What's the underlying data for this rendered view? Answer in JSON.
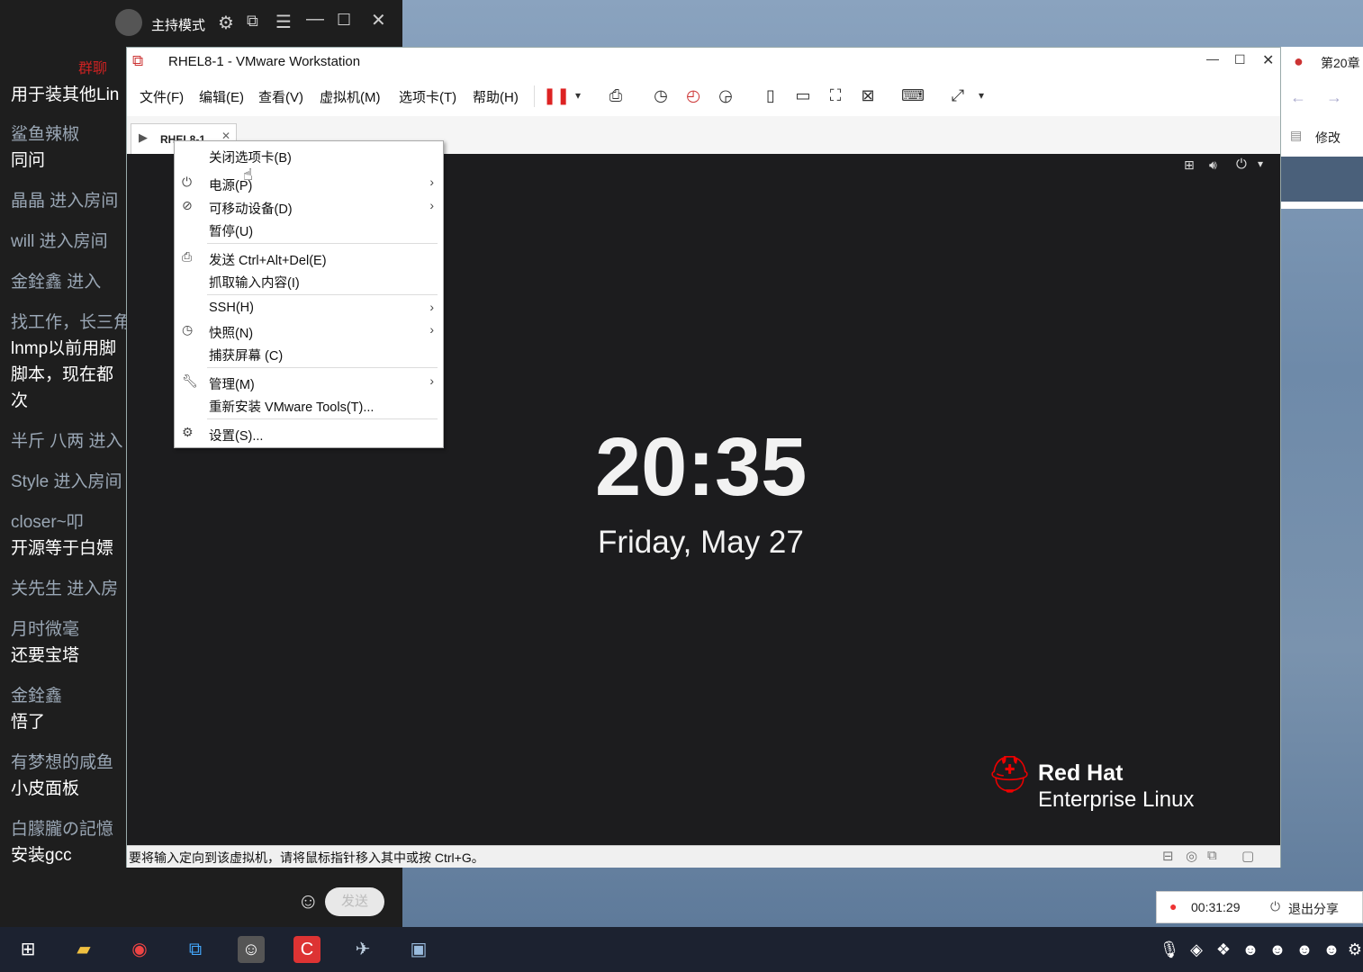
{
  "chat": {
    "host_mode": "主持模式",
    "group_chat_label": "群聊",
    "messages": [
      {
        "name": "",
        "text": "用于装其他Lin"
      },
      {
        "name": "鲨鱼辣椒",
        "text": "同问"
      },
      {
        "name": "晶晶 进入房间",
        "text": ""
      },
      {
        "name": "will 进入房间",
        "text": ""
      },
      {
        "name": "金銓鑫      进入",
        "text": ""
      },
      {
        "name": "找工作，长三角",
        "text": "lnmp以前用脚"
      },
      {
        "name": "",
        "text": "脚本，现在都"
      },
      {
        "name": "",
        "text": "次"
      },
      {
        "name": "半斤  八两 进入",
        "text": ""
      },
      {
        "name": "Style 进入房间",
        "text": ""
      },
      {
        "name": "closer~叩",
        "text": "开源等于白嫖"
      },
      {
        "name": "关先生 进入房",
        "text": ""
      },
      {
        "name": "月时微毫",
        "text": "还要宝塔"
      },
      {
        "name": "金銓鑫",
        "text": "悟了"
      },
      {
        "name": "有梦想的咸鱼",
        "text": "小皮面板"
      },
      {
        "name": "白朦朧の記憶",
        "text": "安装gcc"
      }
    ],
    "send_label": "发送"
  },
  "vmware": {
    "title": "RHEL8-1 - VMware Workstation",
    "menus": [
      "文件(F)",
      "编辑(E)",
      "查看(V)",
      "虚拟机(M)",
      "选项卡(T)",
      "帮助(H)"
    ],
    "tab_label": "RHEL8-1",
    "status_text": "要将输入定向到该虚拟机，请将鼠标指针移入其中或按 Ctrl+G。"
  },
  "context_menu": {
    "items": [
      {
        "label": "关闭选项卡(B)",
        "arrow": false
      },
      {
        "label": "电源(P)",
        "arrow": true
      },
      {
        "label": "可移动设备(D)",
        "arrow": true
      },
      {
        "label": "暂停(U)",
        "arrow": false
      },
      {
        "label": "发送 Ctrl+Alt+Del(E)",
        "arrow": false
      },
      {
        "label": "抓取输入内容(I)",
        "arrow": false
      },
      {
        "label": "SSH(H)",
        "arrow": true
      },
      {
        "label": "快照(N)",
        "arrow": true
      },
      {
        "label": "捕获屏幕 (C)",
        "arrow": false
      },
      {
        "label": "管理(M)",
        "arrow": true
      },
      {
        "label": "重新安装 VMware Tools(T)...",
        "arrow": false
      },
      {
        "label": "设置(S)...",
        "arrow": false
      }
    ]
  },
  "guest": {
    "time": "20:35",
    "date": "Friday, May 27",
    "brand_line1": "Red Hat",
    "brand_line2": "Enterprise Linux"
  },
  "right_panel": {
    "chapter": "第20章",
    "edit_label": "修改"
  },
  "recording": {
    "elapsed": "00:31:29",
    "exit_share": "退出分享"
  },
  "colors": {
    "accent_red": "#cc2222",
    "vm_screen_bg": "#1c1c1e",
    "chat_bg": "#1e1e1e"
  }
}
